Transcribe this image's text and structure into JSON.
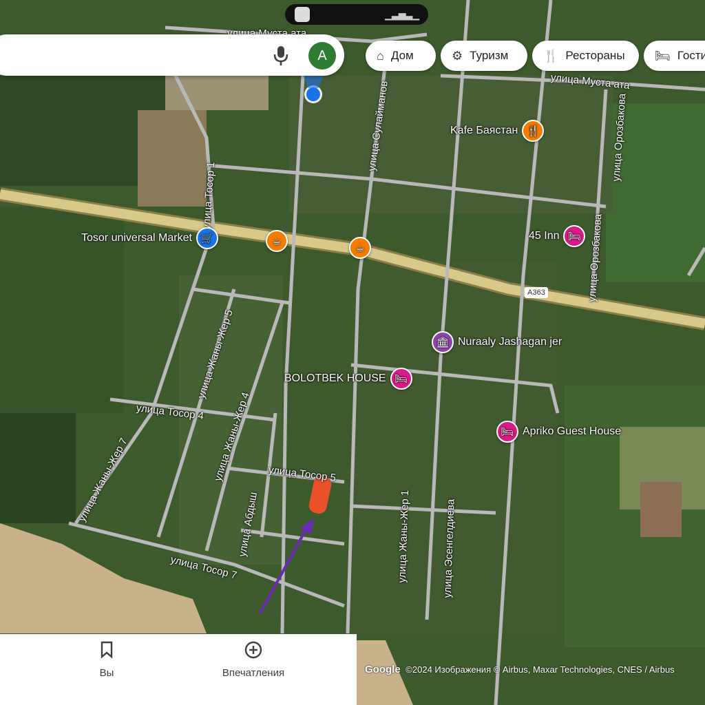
{
  "colors": {
    "satellite_base": "#3d5a2c",
    "field_dark": "#2f4a24",
    "field_light": "#6b7a45",
    "sand": "#c9b28a",
    "highway": "#d8c98a",
    "road": "#b9b9b9",
    "poi_food": "#f57c00",
    "poi_lodging": "#d81b87",
    "poi_event": "#8e44ad",
    "poi_shop": "#1a73e8",
    "marker": "#e8512a",
    "arrow": "#6a2cb3",
    "location_dot": "#1a73e8",
    "avatar": "#2e7d32"
  },
  "search": {
    "mic_icon": "microphone-icon",
    "avatar_letter": "А"
  },
  "chips": [
    {
      "icon": "home-icon",
      "label": "Дом"
    },
    {
      "icon": "tourism-icon",
      "label": "Туризм"
    },
    {
      "icon": "restaurant-icon",
      "label": "Рестораны"
    },
    {
      "icon": "hotel-icon",
      "label": "Гостиницы"
    }
  ],
  "streets": [
    {
      "name": "улица Муста ата"
    },
    {
      "name": "улица Муста ата"
    },
    {
      "name": "улица Сулайманов"
    },
    {
      "name": "улица Орозбакова"
    },
    {
      "name": "улица Орозбакова"
    },
    {
      "name": "улица Тосор 1"
    },
    {
      "name": "улица Жаны-Жер 5"
    },
    {
      "name": "улица Жаны-Жер 4"
    },
    {
      "name": "улица Тосор 4"
    },
    {
      "name": "улица Жаны-Жер 7"
    },
    {
      "name": "улица Абдыш"
    },
    {
      "name": "улица Тосор 5"
    },
    {
      "name": "улица Тосор 7"
    },
    {
      "name": "улица Жаны-Жер 1"
    },
    {
      "name": "улица Эсенгелдиева"
    }
  ],
  "pois": [
    {
      "name": "Kafe Баястан",
      "icon": "fork-knife-icon",
      "type": "food"
    },
    {
      "name": "Tosor universal Market",
      "icon": "shopping-cart-icon",
      "type": "shop"
    },
    {
      "name": "45 Inn",
      "icon": "bed-icon",
      "type": "lodging"
    },
    {
      "name": "Nuraaly Jashagan jer",
      "icon": "building-icon",
      "type": "event"
    },
    {
      "name": "BOLOTBEK HOUSE",
      "icon": "bed-icon",
      "type": "lodging"
    },
    {
      "name": "Apriko Guest House",
      "icon": "bed-icon",
      "type": "lodging"
    },
    {
      "name": "",
      "icon": "coffee-icon",
      "type": "food"
    },
    {
      "name": "",
      "icon": "coffee-icon",
      "type": "food"
    }
  ],
  "route_badge": "A363",
  "bottom_sheet": {
    "buttons": [
      {
        "icon": "bookmark-icon",
        "label": "Вы"
      },
      {
        "icon": "add-circle-icon",
        "label": "Впечатления"
      }
    ]
  },
  "attribution": {
    "brand": "Google",
    "text": "©2024 Изображения © Airbus, Maxar Technologies, CNES / Airbus"
  }
}
